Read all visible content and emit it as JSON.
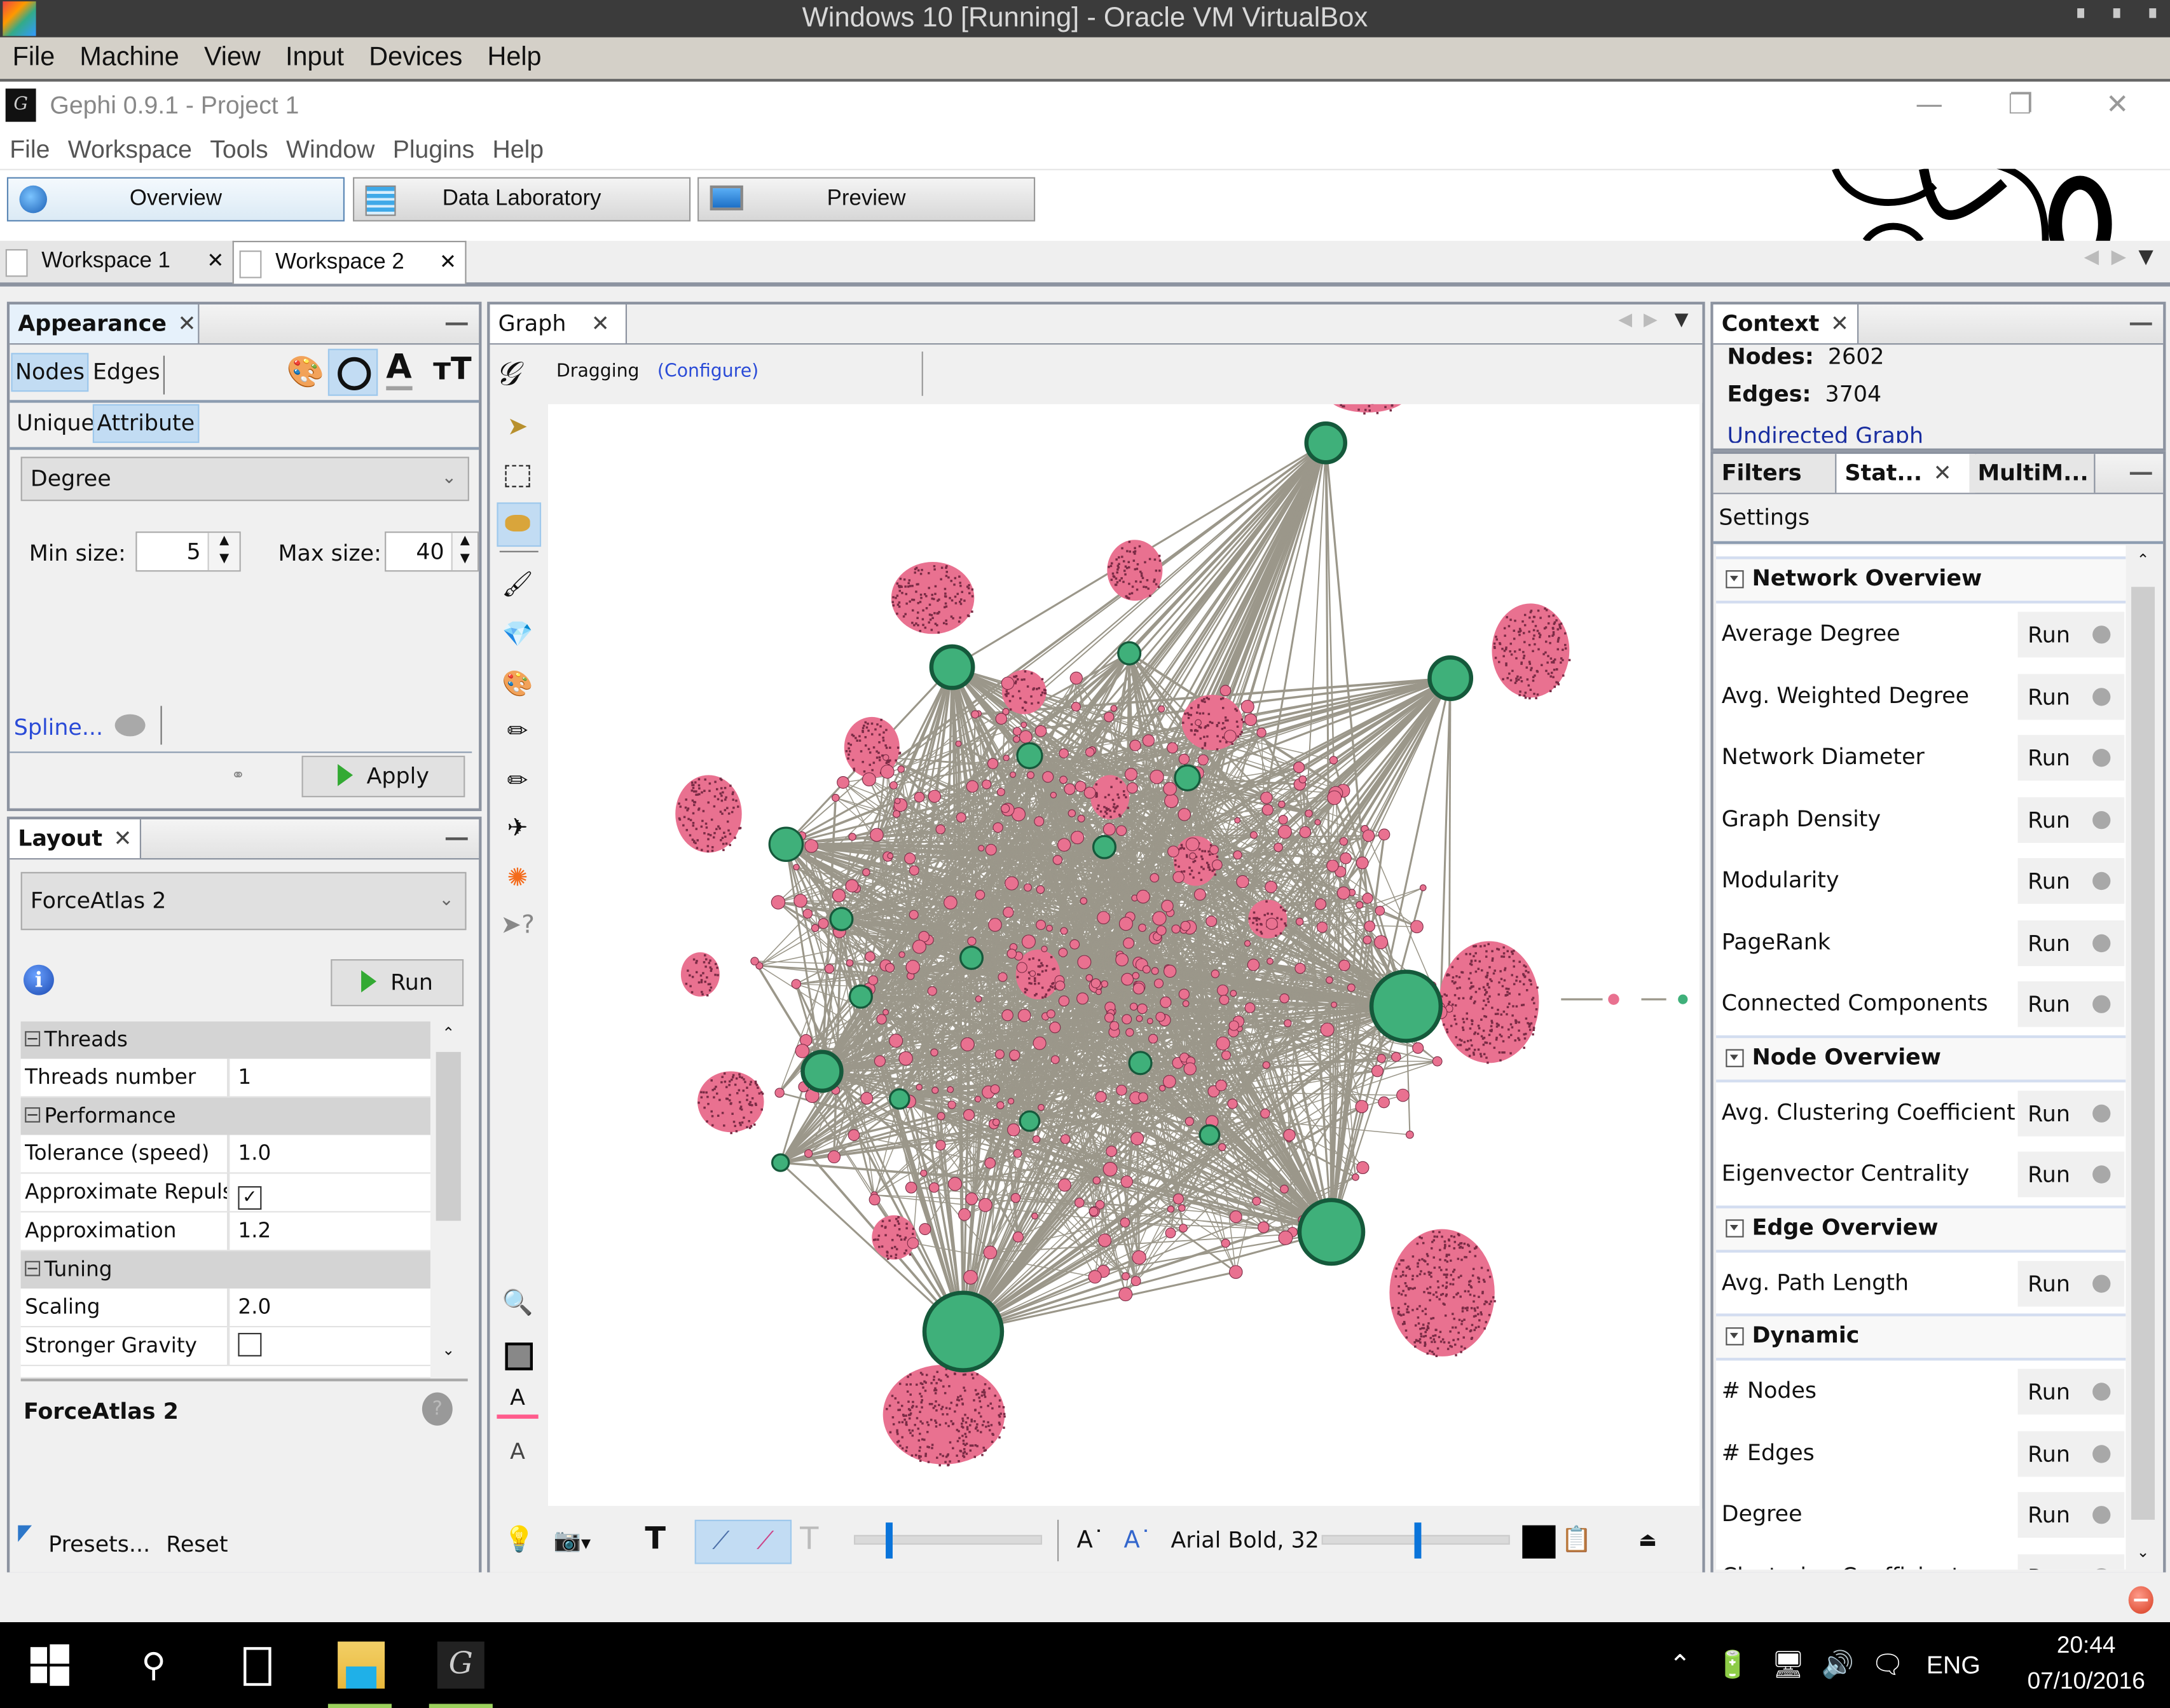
{
  "vm_window": {
    "title": "Windows 10 [Running] - Oracle VM VirtualBox",
    "menu": [
      "File",
      "Machine",
      "View",
      "Input",
      "Devices",
      "Help"
    ]
  },
  "app": {
    "title": "Gephi 0.9.1 - Project 1",
    "menu": [
      "File",
      "Workspace",
      "Tools",
      "Window",
      "Plugins",
      "Help"
    ],
    "perspectives": [
      {
        "label": "Overview",
        "icon": "globe-icon",
        "active": true
      },
      {
        "label": "Data Laboratory",
        "icon": "spreadsheet-icon",
        "active": false
      },
      {
        "label": "Preview",
        "icon": "monitor-icon",
        "active": false
      }
    ],
    "workspaces": [
      {
        "label": "Workspace 1",
        "active": false
      },
      {
        "label": "Workspace 2",
        "active": true
      }
    ]
  },
  "appearance": {
    "tab": "Appearance",
    "target_tabs": [
      "Nodes",
      "Edges"
    ],
    "target_selected": "Nodes",
    "property_icons": [
      "palette-icon",
      "size-icon",
      "label-color-icon",
      "label-size-icon"
    ],
    "property_selected": "size-icon",
    "mode_tabs": [
      "Unique",
      "Attribute"
    ],
    "mode_selected": "Attribute",
    "attribute": "Degree",
    "min_size_label": "Min size:",
    "min_size": "5",
    "max_size_label": "Max size:",
    "max_size": "40",
    "spline_link": "Spline...",
    "apply_label": "Apply"
  },
  "layout": {
    "tab": "Layout",
    "algorithm": "ForceAtlas 2",
    "run_label": "Run",
    "properties": [
      {
        "type": "category",
        "label": "Threads"
      },
      {
        "type": "prop",
        "label": "Threads number",
        "value": "1"
      },
      {
        "type": "category",
        "label": "Performance"
      },
      {
        "type": "prop",
        "label": "Tolerance (speed)",
        "value": "1.0"
      },
      {
        "type": "check",
        "label": "Approximate Repulsion",
        "checked": true
      },
      {
        "type": "prop",
        "label": "Approximation",
        "value": "1.2"
      },
      {
        "type": "category",
        "label": "Tuning"
      },
      {
        "type": "prop",
        "label": "Scaling",
        "value": "2.0"
      },
      {
        "type": "check",
        "label": "Stronger Gravity",
        "checked": false
      }
    ],
    "description_title": "ForceAtlas 2",
    "presets_label": "Presets...",
    "reset_label": "Reset"
  },
  "graph": {
    "tab": "Graph",
    "mode": "Dragging",
    "configure_link": "(Configure)",
    "font_label": "Arial Bold, 32",
    "node_color_a": "#e97190",
    "node_color_b": "#3fb07a",
    "node_outline_a": "#7a2b45",
    "node_outline_b": "#15593b",
    "edge_color": "#9b978a"
  },
  "context": {
    "tab": "Context",
    "nodes_label": "Nodes:",
    "nodes": "2602",
    "edges_label": "Edges:",
    "edges": "3704",
    "graph_type": "Undirected Graph"
  },
  "statistics": {
    "tabs": [
      "Filters",
      "Stat...",
      "MultiM..."
    ],
    "active_tab": "Stat...",
    "settings_label": "Settings",
    "run_label": "Run",
    "groups": [
      {
        "title": "Network Overview",
        "items": [
          "Average Degree",
          "Avg. Weighted Degree",
          "Network Diameter",
          "Graph Density",
          "Modularity",
          "PageRank",
          "Connected Components"
        ]
      },
      {
        "title": "Node Overview",
        "items": [
          "Avg. Clustering Coefficient",
          "Eigenvector Centrality"
        ]
      },
      {
        "title": "Edge Overview",
        "items": [
          "Avg. Path Length"
        ]
      },
      {
        "title": "Dynamic",
        "items": [
          "# Nodes",
          "# Edges",
          "Degree",
          "Clustering Coefficient"
        ]
      }
    ]
  },
  "taskbar": {
    "time": "20:44",
    "date": "07/10/2016",
    "language": "ENG"
  }
}
